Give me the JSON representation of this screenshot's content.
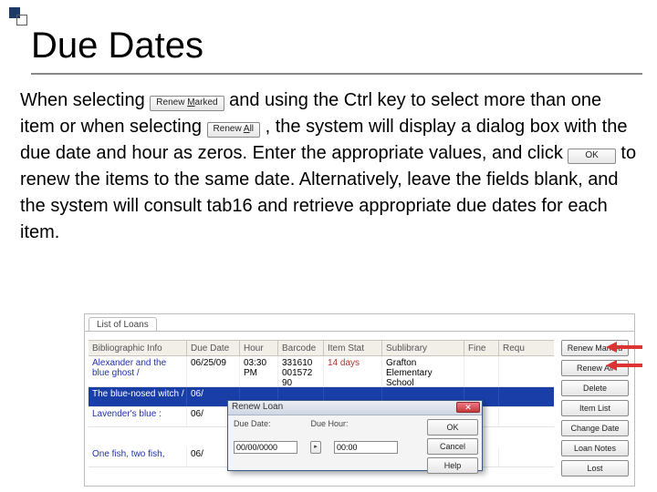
{
  "title": "Due Dates",
  "para": {
    "t1": "When selecting ",
    "btn1_prefix": "Renew ",
    "btn1_u": "M",
    "btn1_suffix": "arked",
    "t2": " and using the Ctrl key to select more than one item or when selecting ",
    "btn2_prefix": "Renew ",
    "btn2_u": "A",
    "btn2_suffix": "ll",
    "t3": ", the system will display a dialog box with the due date and hour as zeros.  Enter the appropriate values, and click ",
    "btn3": "OK",
    "t4": " to renew the items to the same date.  Alternatively, leave the fields blank, and the system will consult tab16 and retrieve appropriate due dates for each item."
  },
  "shot": {
    "tab": "List of Loans",
    "headers": {
      "bib": "Bibliographic Info",
      "due": "Due Date",
      "hour": "Hour",
      "barcode": "Barcode",
      "status": "Item Stat",
      "sublib": "Sublibrary",
      "fine": "Fine",
      "req": "Requ"
    },
    "rows": [
      {
        "bib": "Alexander and the blue ghost /",
        "due": "06/25/09",
        "hour": "03:30 PM",
        "barcode": "331610 001572 90",
        "status": "14 days",
        "sublib": "Grafton Elementary School"
      },
      {
        "bib": "The blue-nosed witch /",
        "due": "06/",
        "hour": "",
        "barcode": "",
        "status": "",
        "sublib": ""
      },
      {
        "bib": "Lavender's blue :",
        "due": "06/",
        "hour": "",
        "barcode": "",
        "status": "",
        "sublib": ""
      },
      {
        "bib": "One fish, two fish,",
        "due": "06/",
        "hour": "",
        "barcode": "",
        "status": "",
        "sublib": ""
      }
    ],
    "buttons": {
      "renew_marked": "Renew Marked",
      "renew_all": "Renew All",
      "delete": "Delete",
      "item_list": "Item List",
      "change_date": "Change Date",
      "loan_notes": "Loan Notes",
      "lost": "Lost"
    },
    "dialog": {
      "title": "Renew Loan",
      "lbl_date": "Due Date:",
      "lbl_hour": "Due Hour:",
      "val_date": "00/00/0000",
      "val_hour": "00:00",
      "ok": "OK",
      "cancel": "Cancel",
      "help": "Help"
    }
  }
}
